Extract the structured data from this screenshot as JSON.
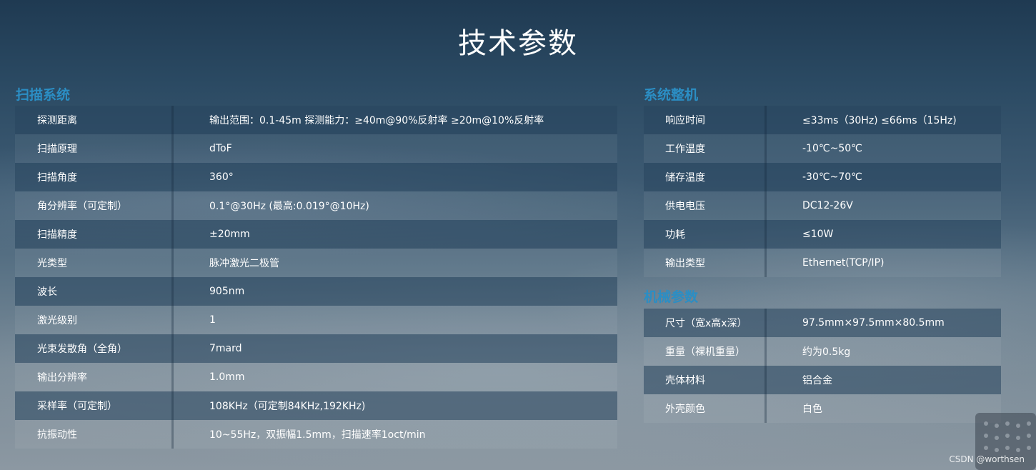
{
  "page": {
    "title": "技术参数",
    "watermark": "CSDN @worthsen"
  },
  "scan_system": {
    "title": "扫描系统",
    "rows": [
      {
        "label": "探测距离",
        "value": "输出范围：0.1-45m 探测能力：≥40m@90%反射率 ≥20m@10%反射率"
      },
      {
        "label": "扫描原理",
        "value": "dToF"
      },
      {
        "label": "扫描角度",
        "value": "360°"
      },
      {
        "label": "角分辨率（可定制）",
        "value": "0.1°@30Hz (最高:0.019°@10Hz)"
      },
      {
        "label": "扫描精度",
        "value": "±20mm"
      },
      {
        "label": "光类型",
        "value": "脉冲激光二极管"
      },
      {
        "label": "波长",
        "value": "905nm"
      },
      {
        "label": "激光级别",
        "value": "1"
      },
      {
        "label": "光束发散角（全角）",
        "value": "7mard"
      },
      {
        "label": "输出分辨率",
        "value": "1.0mm"
      },
      {
        "label": "采样率（可定制）",
        "value": "108KHz（可定制84KHz,192KHz)"
      },
      {
        "label": "抗振动性",
        "value": "10~55Hz，双振幅1.5mm，扫描速率1oct/min"
      }
    ]
  },
  "system_overall": {
    "title": "系统整机",
    "rows": [
      {
        "label": "响应时间",
        "value": "≤33ms（30Hz) ≤66ms（15Hz)"
      },
      {
        "label": "工作温度",
        "value": "-10℃~50℃"
      },
      {
        "label": "储存温度",
        "value": "-30℃~70℃"
      },
      {
        "label": "供电电压",
        "value": "DC12-26V"
      },
      {
        "label": "功耗",
        "value": "≤10W"
      },
      {
        "label": "输出类型",
        "value": "Ethernet(TCP/IP)"
      }
    ]
  },
  "mechanical": {
    "title": "机械参数",
    "rows": [
      {
        "label": "尺寸（宽x高x深）",
        "value": "97.5mm×97.5mm×80.5mm"
      },
      {
        "label": "重量（裸机重量）",
        "value": "约为0.5kg"
      },
      {
        "label": "壳体材料",
        "value": "铝合金"
      },
      {
        "label": "外壳颜色",
        "value": "白色"
      }
    ]
  },
  "colors": {
    "section_title": "#2b8ec4",
    "text": "#ffffff"
  }
}
